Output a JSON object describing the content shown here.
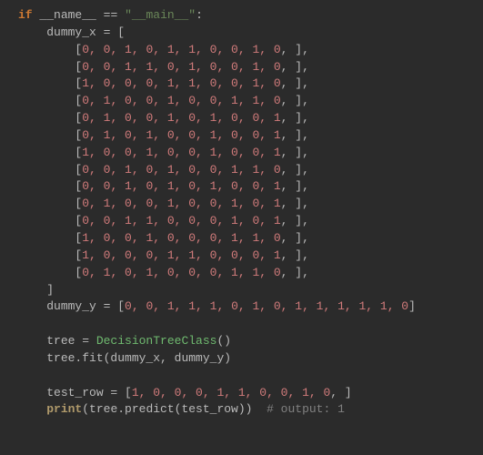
{
  "kw_if": "if",
  "dunder_name": "__name__",
  "eq": " == ",
  "main_str": "\"__main__\"",
  "colon": ":",
  "indent1": "    ",
  "indent2": "        ",
  "dummy_x_decl": "dummy_x = [",
  "rows": [
    "0, 0, 1, 0, 1, 1, 0, 0, 1, 0",
    "0, 0, 1, 1, 0, 1, 0, 0, 1, 0",
    "1, 0, 0, 0, 1, 1, 0, 0, 1, 0",
    "0, 1, 0, 0, 1, 0, 0, 1, 1, 0",
    "0, 1, 0, 0, 1, 0, 1, 0, 0, 1",
    "0, 1, 0, 1, 0, 0, 1, 0, 0, 1",
    "1, 0, 0, 1, 0, 0, 1, 0, 0, 1",
    "0, 0, 1, 0, 1, 0, 0, 1, 1, 0",
    "0, 0, 1, 0, 1, 0, 1, 0, 0, 1",
    "0, 1, 0, 0, 1, 0, 0, 1, 0, 1",
    "0, 0, 1, 1, 0, 0, 0, 1, 0, 1",
    "1, 0, 0, 1, 0, 0, 0, 1, 1, 0",
    "1, 0, 0, 0, 1, 1, 0, 0, 0, 1",
    "0, 1, 0, 1, 0, 0, 0, 1, 1, 0"
  ],
  "row_open": "[",
  "row_close": ", ],",
  "list_close": "]",
  "dummy_y_lhs": "dummy_y = [",
  "dummy_y_vals": "0, 0, 1, 1, 1, 0, 1, 0, 1, 1, 1, 1, 1, 0",
  "dummy_y_close": "]",
  "tree_assign_lhs": "tree = ",
  "class_name": "DecisionTreeClass",
  "open_close": "()",
  "fit_call": "tree.fit(dummy_x, dummy_y)",
  "test_row_lhs": "test_row = [",
  "test_row_vals": "1, 0, 0, 0, 1, 1, 0, 0, 1, 0",
  "test_row_close": ", ]",
  "print_kw": "print",
  "print_args": "(tree.predict(test_row))",
  "comment": "# output: 1",
  "two_sp": "  "
}
